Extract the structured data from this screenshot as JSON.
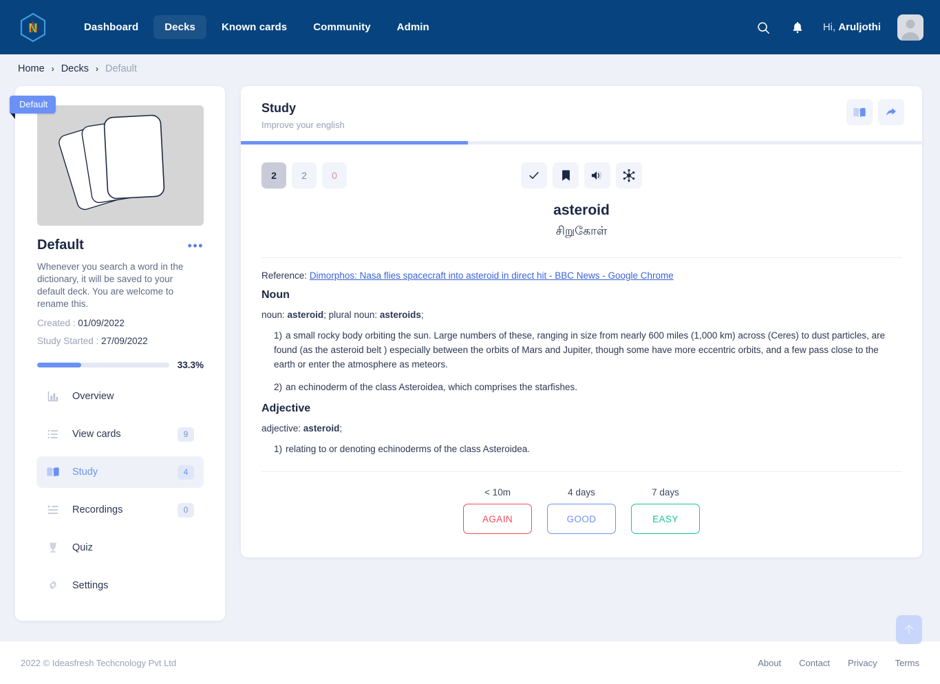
{
  "header": {
    "logo_letter": "N",
    "nav": [
      {
        "label": "Dashboard",
        "active": false
      },
      {
        "label": "Decks",
        "active": true
      },
      {
        "label": "Known cards",
        "active": false
      },
      {
        "label": "Community",
        "active": false
      },
      {
        "label": "Admin",
        "active": false
      }
    ],
    "search_icon": "search-icon",
    "bell_icon": "notification-bell-icon",
    "greeting_prefix": "Hi, ",
    "user_name": "Aruljothi"
  },
  "breadcrumb": {
    "items": [
      "Home",
      "Decks",
      "Default"
    ],
    "separator": "›"
  },
  "deck": {
    "ribbon_label": "Default",
    "title": "Default",
    "menu_dots": "•••",
    "description": "Whenever you search a word in the dictionary, it will be saved to your default deck. You are welcome to rename this.",
    "created_label": "Created :",
    "created_value": "01/09/2022",
    "study_started_label": "Study Started :",
    "study_started_value": "27/09/2022",
    "progress_percent_label": "33.3%",
    "progress_percent": 33.3,
    "menu": [
      {
        "label": "Overview",
        "icon": "bar-chart-icon",
        "badge": null,
        "active": false
      },
      {
        "label": "View cards",
        "icon": "list-icon",
        "badge": "9",
        "active": false
      },
      {
        "label": "Study",
        "icon": "open-book-icon",
        "badge": "4",
        "active": true
      },
      {
        "label": "Recordings",
        "icon": "playlist-icon",
        "badge": "0",
        "active": false
      },
      {
        "label": "Quiz",
        "icon": "trophy-icon",
        "badge": null,
        "active": false
      },
      {
        "label": "Settings",
        "icon": "gear-icon",
        "badge": null,
        "active": false
      }
    ]
  },
  "study": {
    "title": "Study",
    "subtitle": "Improve your english",
    "progress_percent": 33.3,
    "head_buttons": [
      {
        "name": "book-icon"
      },
      {
        "name": "share-arrow-icon"
      }
    ],
    "counts": [
      {
        "value": "2",
        "kind": "new"
      },
      {
        "value": "2",
        "kind": "learning"
      },
      {
        "value": "0",
        "kind": "due"
      }
    ],
    "tools": [
      {
        "name": "check-icon",
        "glyph": "✓"
      },
      {
        "name": "bookmark-icon",
        "glyph": "⚑"
      },
      {
        "name": "speaker-icon",
        "glyph": "ὐA"
      },
      {
        "name": "network-icon",
        "glyph": "✵"
      }
    ],
    "word": "asteroid",
    "word_translation": "சிறுகோள்",
    "reference_label": "Reference:",
    "reference_link": "Dimorphos: Nasa flies spacecraft into asteroid in direct hit - BBC News - Google Chrome",
    "sections": [
      {
        "heading": "Noun",
        "inflection_prefix": "noun: ",
        "inflection_bold1": "asteroid",
        "inflection_mid": "; plural noun: ",
        "inflection_bold2": "asteroids",
        "inflection_suffix": ";",
        "definitions": [
          "a small rocky body orbiting the sun. Large numbers of these, ranging in size from nearly 600 miles (1,000 km) across (Ceres) to dust particles, are found (as the asteroid belt ) especially between the orbits of Mars and Jupiter, though some have more eccentric orbits, and a few pass close to the earth or enter the atmosphere as meteors.",
          "an echinoderm of the class Asteroidea, which comprises the starfishes."
        ]
      },
      {
        "heading": "Adjective",
        "inflection_prefix": "adjective: ",
        "inflection_bold1": "asteroid",
        "inflection_mid": "",
        "inflection_bold2": "",
        "inflection_suffix": ";",
        "definitions": [
          "relating to or denoting echinoderms of the class Asteroidea."
        ]
      }
    ],
    "answers": [
      {
        "time": "< 10m",
        "label": "AGAIN",
        "color": "#ef4b5c"
      },
      {
        "time": "4 days",
        "label": "GOOD",
        "color": "#6b91f7"
      },
      {
        "time": "7 days",
        "label": "EASY",
        "color": "#18c39a"
      }
    ]
  },
  "footer": {
    "copyright": "2022 © Ideasfresh Techcnology Pvt Ltd",
    "links": [
      "About",
      "Contact",
      "Privacy",
      "Terms"
    ],
    "scroll_top_icon": "arrow-up-icon"
  },
  "colors": {
    "nav_bg": "#07437e",
    "accent": "#6b91f7",
    "page_bg": "#eef1f8",
    "danger": "#ef4b5c",
    "success": "#18c39a"
  }
}
